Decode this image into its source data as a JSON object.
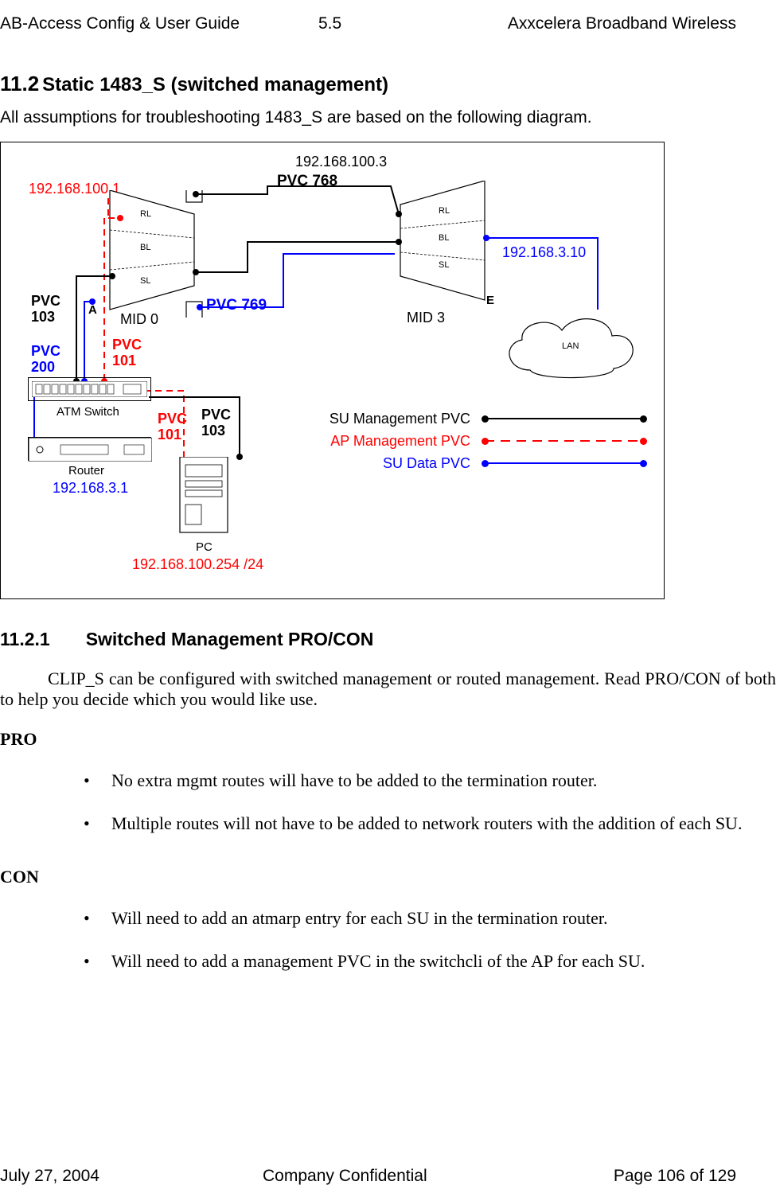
{
  "header": {
    "left": "AB-Access Config & User Guide",
    "center": "5.5",
    "right": "Axxcelera Broadband Wireless"
  },
  "footer": {
    "left": "July 27, 2004",
    "center": "Company Confidential",
    "right": "Page 106 of 129"
  },
  "section": {
    "num": "11.2",
    "title": "Static 1483_S (switched management)"
  },
  "intro": "All assumptions for troubleshooting 1483_S are based on the following diagram.",
  "diagram": {
    "ip_top": "192.168.100.3",
    "ip_left": "192.168.100.1",
    "ip_lan": "192.168.3.10",
    "ip_router": "192.168.3.1",
    "ip_pc": "192.168.100.254 /24",
    "pvc768": "PVC 768",
    "pvc769": "PVC 769",
    "pvc103a": "PVC 103",
    "pvc103b": "PVC 103",
    "pvc200": "PVC 200",
    "pvc101a": "PVC 101",
    "pvc101b": "PVC 101",
    "labelA": "A",
    "labelE": "E",
    "mid0": "MID 0",
    "mid3": "MID 3",
    "layers": {
      "rl": "RL",
      "bl": "BL",
      "sl": "SL"
    },
    "atm": "ATM Switch",
    "router": "Router",
    "pc": "PC",
    "lan": "LAN",
    "legend": {
      "su_mgmt": "SU Management PVC",
      "ap_mgmt": "AP Management PVC",
      "su_data": "SU Data PVC"
    }
  },
  "subsection": {
    "num": "11.2.1",
    "title": "Switched Management PRO/CON"
  },
  "body": {
    "para": "CLIP_S can be configured with switched management or routed management. Read PRO/CON of both to help you decide which you would like use.",
    "pro_label": "PRO",
    "pro": [
      "No extra mgmt routes will have to be added to the termination router.",
      "Multiple routes will not have to be added to network routers with the addition of each SU."
    ],
    "con_label": "CON",
    "con": [
      "Will need to add an atmarp entry for each SU in the termination router.",
      "Will need to add a management PVC in the switchcli of the AP for each SU."
    ]
  }
}
